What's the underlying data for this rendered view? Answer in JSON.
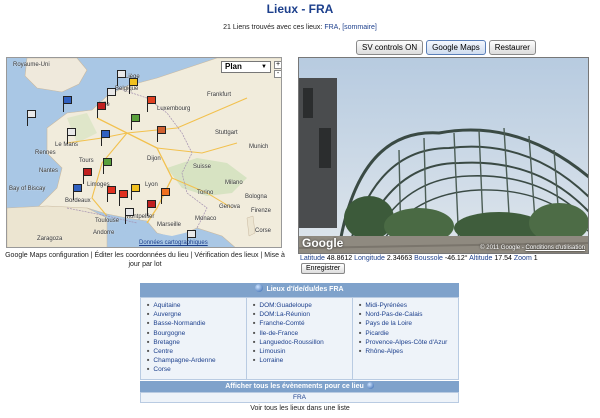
{
  "page": {
    "title": "Lieux - FRA",
    "count_text": "21 Liens trouvés avec ces lieux:",
    "count_place": "FRA",
    "count_link": "[sommaire]"
  },
  "buttons": {
    "sv_controls": "SV controls ON",
    "google_maps": "Google Maps",
    "restore": "Restaurer"
  },
  "map": {
    "type_select": "Plan",
    "zoom_in": "+",
    "zoom_out": "-",
    "footer_data": "Données cartographiques",
    "labels": {
      "uk": "Royaume-Uni",
      "belgique": "Belgique",
      "lille": "Lille",
      "liege": "Liège",
      "luxembourg": "Luxembourg",
      "frankfurt": "Frankfurt",
      "stuttgart": "Stuttgart",
      "munich": "Munich",
      "rennes": "Rennes",
      "nantes": "Nantes",
      "tours": "Tours",
      "dijon": "Dijon",
      "limoges": "Limoges",
      "lyon": "Lyon",
      "bordeaux": "Bordeaux",
      "toulouse": "Toulouse",
      "montpellier": "Montpellier",
      "monaco": "Monaco",
      "suisse": "Suisse",
      "genova": "Genova",
      "bologna": "Bologna",
      "firenze": "Firenze",
      "bay": "Bay of Biscay",
      "marseille": "Marseille",
      "lechamps": "Le Mans",
      "andorre": "Andorre",
      "zaragoza": "Zaragoza",
      "milano": "Milano",
      "torino": "Torino",
      "corsica": "Corse"
    }
  },
  "map_caption": "Google Maps configuration | Éditer les coordonnées du lieu | Vérification des lieux | Mise à jour par lot",
  "streetview": {
    "brand": "Google",
    "copyright": "© 2011 Google - ",
    "terms": "Conditions d'utilisation"
  },
  "coords": {
    "lat_label": "Latitude",
    "lat": "48.8612",
    "lon_label": "Longitude",
    "lon": "2.34663",
    "compass_label": "Boussole",
    "compass": "-46.12°",
    "alt_label": "Altitude",
    "alt": "17.54",
    "zoom_label": "Zoom",
    "zoom": "1",
    "save": "Enregistrer"
  },
  "table": {
    "header": "Lieux d'/de/du/des FRA",
    "col1": [
      "Aquitaine",
      "Auvergne",
      "Basse-Normandie",
      "Bourgogne",
      "Bretagne",
      "Centre",
      "Champagne-Ardenne",
      "Corse"
    ],
    "col2": [
      "DOM:Guadeloupe",
      "DOM:La-Réunion",
      "Franche-Comté",
      "Ile-de-France",
      "Languedoc-Roussillon",
      "Limousin",
      "Lorraine"
    ],
    "col3": [
      "Midi-Pyrénées",
      "Nord-Pas-de-Calais",
      "Pays de la Loire",
      "Picardie",
      "Provence-Alpes-Côte d'Azur",
      "Rhône-Alpes"
    ],
    "events_header": "Afficher tous les évènements pour ce lieu",
    "events_value": "FRA"
  },
  "footer": "Voir tous les lieux dans une liste"
}
